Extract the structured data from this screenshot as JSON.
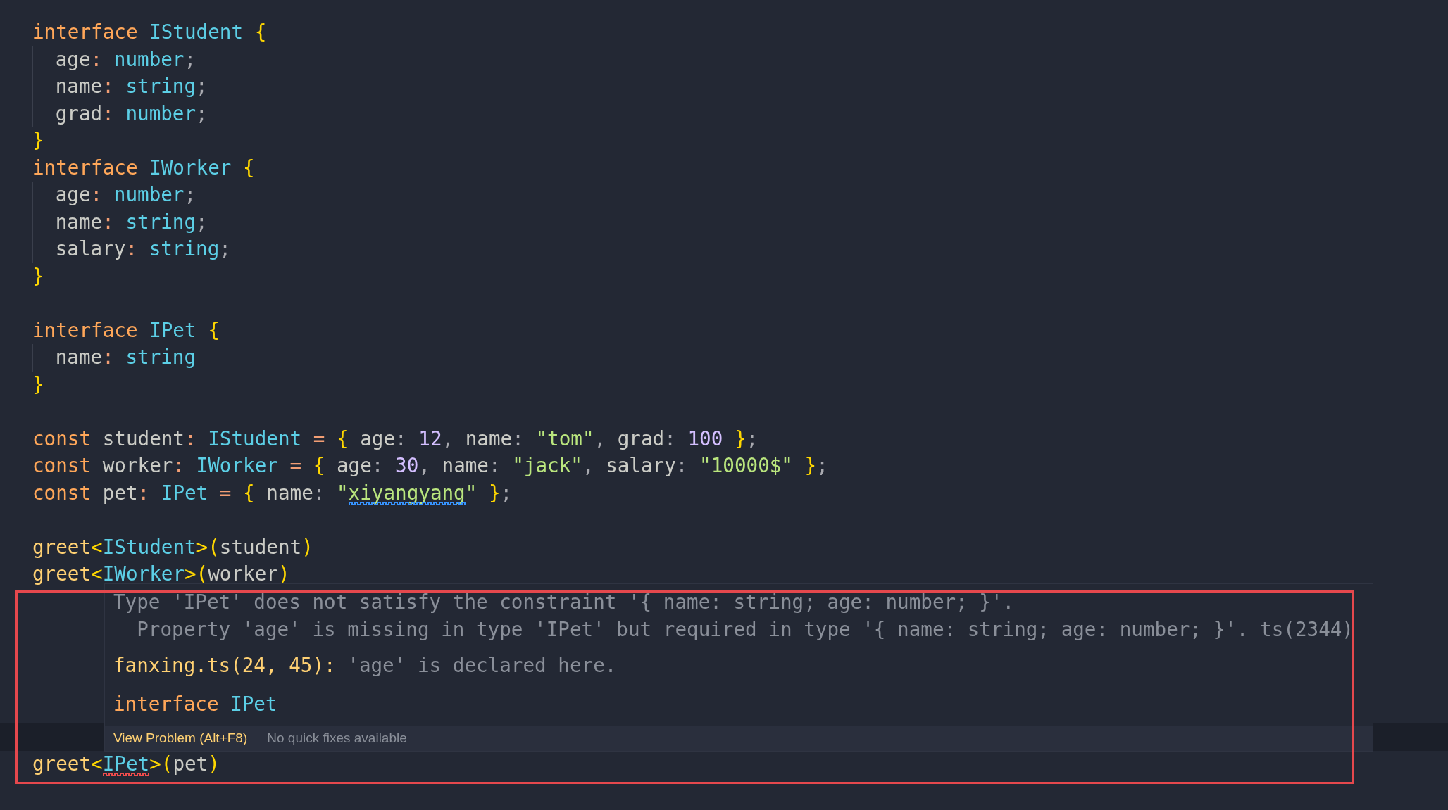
{
  "editor": {
    "lines": [
      {
        "kind": "code",
        "indented": false,
        "tokens": [
          {
            "t": "interface ",
            "kind": "keyword"
          },
          {
            "t": "IStudent ",
            "kind": "type"
          },
          {
            "t": "{",
            "kind": "brace"
          }
        ]
      },
      {
        "kind": "code",
        "indented": true,
        "tokens": [
          {
            "t": "age",
            "kind": "plain"
          },
          {
            "t": ": ",
            "kind": "punct"
          },
          {
            "t": "number",
            "kind": "type"
          },
          {
            "t": ";",
            "kind": "muted"
          }
        ]
      },
      {
        "kind": "code",
        "indented": true,
        "tokens": [
          {
            "t": "name",
            "kind": "plain"
          },
          {
            "t": ": ",
            "kind": "punct"
          },
          {
            "t": "string",
            "kind": "type"
          },
          {
            "t": ";",
            "kind": "muted"
          }
        ]
      },
      {
        "kind": "code",
        "indented": true,
        "tokens": [
          {
            "t": "grad",
            "kind": "plain"
          },
          {
            "t": ": ",
            "kind": "punct"
          },
          {
            "t": "number",
            "kind": "type"
          },
          {
            "t": ";",
            "kind": "muted"
          }
        ]
      },
      {
        "kind": "code",
        "indented": false,
        "tokens": [
          {
            "t": "}",
            "kind": "brace"
          }
        ]
      },
      {
        "kind": "code",
        "indented": false,
        "tokens": [
          {
            "t": "interface ",
            "kind": "keyword"
          },
          {
            "t": "IWorker ",
            "kind": "type"
          },
          {
            "t": "{",
            "kind": "brace"
          }
        ]
      },
      {
        "kind": "code",
        "indented": true,
        "tokens": [
          {
            "t": "age",
            "kind": "plain"
          },
          {
            "t": ": ",
            "kind": "punct"
          },
          {
            "t": "number",
            "kind": "type"
          },
          {
            "t": ";",
            "kind": "muted"
          }
        ]
      },
      {
        "kind": "code",
        "indented": true,
        "tokens": [
          {
            "t": "name",
            "kind": "plain"
          },
          {
            "t": ": ",
            "kind": "punct"
          },
          {
            "t": "string",
            "kind": "type"
          },
          {
            "t": ";",
            "kind": "muted"
          }
        ]
      },
      {
        "kind": "code",
        "indented": true,
        "tokens": [
          {
            "t": "salary",
            "kind": "plain"
          },
          {
            "t": ": ",
            "kind": "punct"
          },
          {
            "t": "string",
            "kind": "type"
          },
          {
            "t": ";",
            "kind": "muted"
          }
        ]
      },
      {
        "kind": "code",
        "indented": false,
        "tokens": [
          {
            "t": "}",
            "kind": "brace"
          }
        ]
      },
      {
        "kind": "blank"
      },
      {
        "kind": "code",
        "indented": false,
        "tokens": [
          {
            "t": "interface ",
            "kind": "keyword"
          },
          {
            "t": "IPet ",
            "kind": "type"
          },
          {
            "t": "{",
            "kind": "brace"
          }
        ]
      },
      {
        "kind": "code",
        "indented": true,
        "tokens": [
          {
            "t": "name",
            "kind": "plain"
          },
          {
            "t": ": ",
            "kind": "punct"
          },
          {
            "t": "string",
            "kind": "type"
          }
        ]
      },
      {
        "kind": "code",
        "indented": false,
        "tokens": [
          {
            "t": "}",
            "kind": "brace"
          }
        ]
      },
      {
        "kind": "blank"
      },
      {
        "kind": "code",
        "indented": false,
        "tokens": [
          {
            "t": "const ",
            "kind": "keyword"
          },
          {
            "t": "student",
            "kind": "plain"
          },
          {
            "t": ": ",
            "kind": "punct"
          },
          {
            "t": "IStudent",
            "kind": "type"
          },
          {
            "t": " = ",
            "kind": "punct"
          },
          {
            "t": "{ ",
            "kind": "brace"
          },
          {
            "t": "age",
            "kind": "plain"
          },
          {
            "t": ": ",
            "kind": "muted"
          },
          {
            "t": "12",
            "kind": "number"
          },
          {
            "t": ", ",
            "kind": "muted"
          },
          {
            "t": "name",
            "kind": "plain"
          },
          {
            "t": ": ",
            "kind": "muted"
          },
          {
            "t": "\"tom\"",
            "kind": "string"
          },
          {
            "t": ", ",
            "kind": "muted"
          },
          {
            "t": "grad",
            "kind": "plain"
          },
          {
            "t": ": ",
            "kind": "muted"
          },
          {
            "t": "100 ",
            "kind": "number"
          },
          {
            "t": "}",
            "kind": "brace"
          },
          {
            "t": ";",
            "kind": "muted"
          }
        ]
      },
      {
        "kind": "code",
        "indented": false,
        "tokens": [
          {
            "t": "const ",
            "kind": "keyword"
          },
          {
            "t": "worker",
            "kind": "plain"
          },
          {
            "t": ": ",
            "kind": "punct"
          },
          {
            "t": "IWorker",
            "kind": "type"
          },
          {
            "t": " = ",
            "kind": "punct"
          },
          {
            "t": "{ ",
            "kind": "brace"
          },
          {
            "t": "age",
            "kind": "plain"
          },
          {
            "t": ": ",
            "kind": "muted"
          },
          {
            "t": "30",
            "kind": "number"
          },
          {
            "t": ", ",
            "kind": "muted"
          },
          {
            "t": "name",
            "kind": "plain"
          },
          {
            "t": ": ",
            "kind": "muted"
          },
          {
            "t": "\"jack\"",
            "kind": "string"
          },
          {
            "t": ", ",
            "kind": "muted"
          },
          {
            "t": "salary",
            "kind": "plain"
          },
          {
            "t": ": ",
            "kind": "muted"
          },
          {
            "t": "\"10000$\" ",
            "kind": "string"
          },
          {
            "t": "}",
            "kind": "brace"
          },
          {
            "t": ";",
            "kind": "muted"
          }
        ]
      },
      {
        "kind": "code",
        "indented": false,
        "tokens": [
          {
            "t": "const ",
            "kind": "keyword"
          },
          {
            "t": "pet",
            "kind": "plain"
          },
          {
            "t": ": ",
            "kind": "punct"
          },
          {
            "t": "IPet",
            "kind": "type"
          },
          {
            "t": " = ",
            "kind": "punct"
          },
          {
            "t": "{ ",
            "kind": "brace"
          },
          {
            "t": "name",
            "kind": "plain"
          },
          {
            "t": ": ",
            "kind": "muted"
          },
          {
            "t": "\"",
            "kind": "string"
          },
          {
            "t": "xiyangyang",
            "kind": "string",
            "squiggle": {
              "color": "#3794ff"
            }
          },
          {
            "t": "\" ",
            "kind": "string"
          },
          {
            "t": "}",
            "kind": "brace"
          },
          {
            "t": ";",
            "kind": "muted"
          }
        ]
      },
      {
        "kind": "blank"
      },
      {
        "kind": "code",
        "indented": false,
        "tokens": [
          {
            "t": "greet",
            "kind": "function"
          },
          {
            "t": "<",
            "kind": "brace"
          },
          {
            "t": "IStudent",
            "kind": "type"
          },
          {
            "t": ">(",
            "kind": "brace"
          },
          {
            "t": "student",
            "kind": "plain"
          },
          {
            "t": ")",
            "kind": "brace"
          }
        ]
      },
      {
        "kind": "code",
        "indented": false,
        "tokens": [
          {
            "t": "greet",
            "kind": "function"
          },
          {
            "t": "<",
            "kind": "brace"
          },
          {
            "t": "IWorker",
            "kind": "type"
          },
          {
            "t": ">(",
            "kind": "brace"
          },
          {
            "t": "worker",
            "kind": "plain"
          },
          {
            "t": ")",
            "kind": "brace"
          }
        ]
      },
      {
        "kind": "hover_anchor"
      },
      {
        "kind": "blank"
      },
      {
        "kind": "blank"
      },
      {
        "kind": "blank"
      },
      {
        "kind": "blank"
      },
      {
        "kind": "blank"
      },
      {
        "kind": "current_line"
      },
      {
        "kind": "code",
        "indented": false,
        "tokens": [
          {
            "t": "greet",
            "kind": "function"
          },
          {
            "t": "<",
            "kind": "brace"
          },
          {
            "t": "IPet",
            "kind": "type",
            "squiggle": {
              "color": "#f14c4c"
            }
          },
          {
            "t": ">(",
            "kind": "brace"
          },
          {
            "t": "pet",
            "kind": "plain"
          },
          {
            "t": ")",
            "kind": "brace"
          }
        ]
      }
    ]
  },
  "hover": {
    "message": "Type 'IPet' does not satisfy the constraint '{ name: string; age: number; }'.",
    "detail": "Property 'age' is missing in type 'IPet' but required in type '{ name: string; age: number; }'.",
    "code": "ts(2344)",
    "related_location": "fanxing.ts(24, 45):",
    "related_message": "'age' is declared here.",
    "signature": [
      {
        "t": "interface ",
        "kind": "keyword"
      },
      {
        "t": "IPet",
        "kind": "type"
      }
    ],
    "actions": [
      {
        "label": "View Problem (Alt+F8)",
        "kind": "link"
      },
      {
        "label": "No quick fixes available",
        "kind": "note"
      }
    ]
  }
}
